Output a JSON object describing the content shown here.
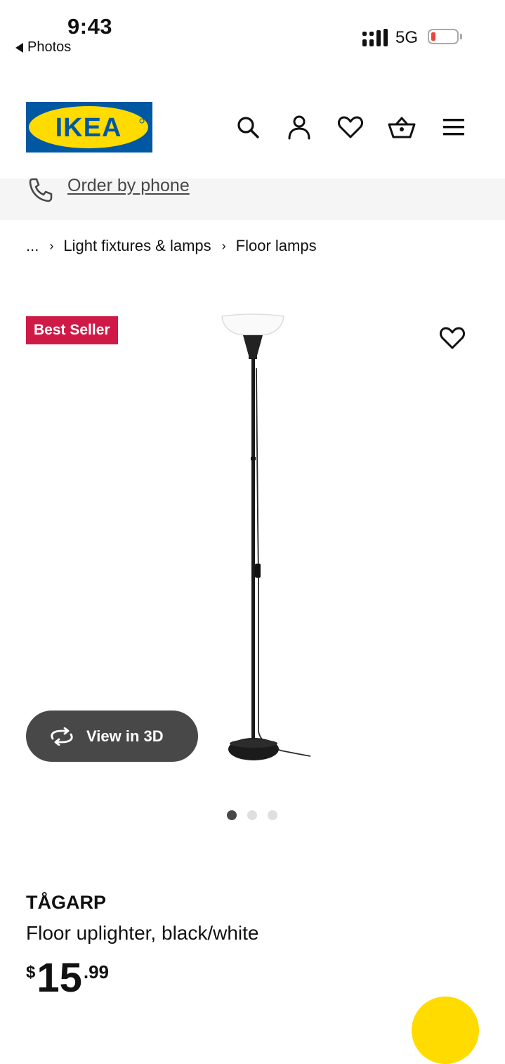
{
  "status_bar": {
    "time": "9:43",
    "back_app": "Photos",
    "network": "5G",
    "battery_level": 0.1
  },
  "header": {
    "logo_text": "IKEA",
    "icons": [
      "search-icon",
      "account-icon",
      "heart-icon",
      "basket-icon",
      "menu-icon"
    ]
  },
  "order_phone": {
    "label": "Order by phone",
    "icon": "phone-icon"
  },
  "breadcrumb": {
    "ellipsis": "...",
    "items": [
      "Light fixtures & lamps",
      "Floor lamps"
    ]
  },
  "product_media": {
    "badge": "Best Seller",
    "view3d_label": "View in 3D",
    "carousel": {
      "count": 3,
      "active_index": 0
    }
  },
  "product": {
    "name": "TÅGARP",
    "description": "Floor uplighter, black/white",
    "price": {
      "currency": "$",
      "integer": "15",
      "decimal": ".99"
    }
  },
  "colors": {
    "ikea_blue": "#0058a3",
    "ikea_yellow": "#ffdb00",
    "badge": "#cf1a47",
    "button_dark": "#484848"
  }
}
